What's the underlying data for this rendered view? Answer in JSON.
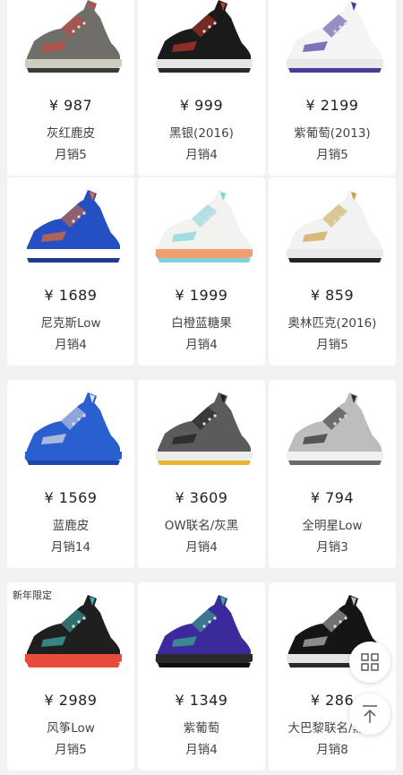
{
  "products": [
    {
      "price": "¥ 987",
      "name": "灰红鹿皮",
      "sales": "月销5",
      "badge": "",
      "colors": {
        "upper": "#6f6e68",
        "midsole": "#cfcbbf",
        "sole": "#3a3a3a",
        "accent": "#c9473c"
      }
    },
    {
      "price": "¥ 999",
      "name": "黑银(2016)",
      "sales": "月销4",
      "badge": "",
      "colors": {
        "upper": "#1a1a1a",
        "midsole": "#e5e5e5",
        "sole": "#2a2a2a",
        "accent": "#c0392b"
      }
    },
    {
      "price": "¥ 2199",
      "name": "紫葡萄(2013)",
      "sales": "月销5",
      "badge": "",
      "colors": {
        "upper": "#f4f4f4",
        "midsole": "#e8e8e8",
        "sole": "#4a3a9a",
        "accent": "#4a3a9a"
      }
    },
    {
      "price": "¥ 1689",
      "name": "尼克斯Low",
      "sales": "月销4",
      "badge": "",
      "colors": {
        "upper": "#2450c4",
        "midsole": "#ffffff",
        "sole": "#1d3c8f",
        "accent": "#e86a2d"
      }
    },
    {
      "price": "¥ 1999",
      "name": "白橙蓝糖果",
      "sales": "月销4",
      "badge": "",
      "colors": {
        "upper": "#f2f2f0",
        "midsole": "#f0a070",
        "sole": "#7fd3d8",
        "accent": "#7fd3d8"
      }
    },
    {
      "price": "¥ 859",
      "name": "奥林匹克(2016)",
      "sales": "月销5",
      "badge": "",
      "colors": {
        "upper": "#f2f2f0",
        "midsole": "#e8e8e8",
        "sole": "#222222",
        "accent": "#c9a34a"
      }
    },
    {
      "price": "¥ 1569",
      "name": "蓝鹿皮",
      "sales": "月销14",
      "badge": "",
      "colors": {
        "upper": "#2a5fd0",
        "midsole": "#2a5fd0",
        "sole": "#1c47a8",
        "accent": "#e0e0e0"
      }
    },
    {
      "price": "¥ 3609",
      "name": "OW联名/灰黑",
      "sales": "月销4",
      "badge": "",
      "colors": {
        "upper": "#5b5b5e",
        "midsole": "#ececec",
        "sole": "#e8b72f",
        "accent": "#1d1d1d"
      }
    },
    {
      "price": "¥ 794",
      "name": "全明星Low",
      "sales": "月销3",
      "badge": "",
      "colors": {
        "upper": "#bdbdbd",
        "midsole": "#f0f0f0",
        "sole": "#6a6a6a",
        "accent": "#2b2b2b"
      }
    },
    {
      "price": "¥ 2989",
      "name": "风筝Low",
      "sales": "月销5",
      "badge": "新年限定",
      "colors": {
        "upper": "#1f1f1f",
        "midsole": "#e64b3c",
        "sole": "#e64b3c",
        "accent": "#3fb0b0"
      }
    },
    {
      "price": "¥ 1349",
      "name": "紫葡萄",
      "sales": "月销4",
      "badge": "",
      "colors": {
        "upper": "#3b2a9c",
        "midsole": "#2a2a2a",
        "sole": "#0f0f0f",
        "accent": "#3fb08a"
      }
    },
    {
      "price": "¥ 286",
      "name": "大巴黎联名/黑银",
      "sales": "月销8",
      "badge": "",
      "colors": {
        "upper": "#151515",
        "midsole": "#e6e6e6",
        "sole": "#2a2a2a",
        "accent": "#bdbdbd"
      }
    }
  ],
  "fabs": {
    "grid_icon": "grid-icon",
    "top_icon": "arrow-up-icon"
  }
}
